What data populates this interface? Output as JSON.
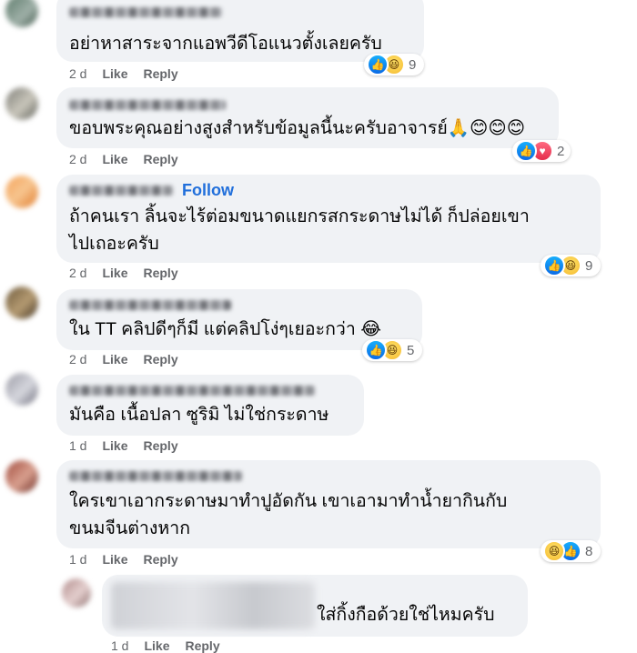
{
  "comments": [
    {
      "text_lines": [
        "อย่าหาสาระจากแอพวีดีโอแนวตั้งเลยครับ"
      ],
      "time": "2 d",
      "like": "Like",
      "reply": "Reply",
      "reactions": "9"
    },
    {
      "text_lines": [
        "ขอบพระคุณอย่างสูงสำหรับข้อมูลนี้นะครับอาจารย์🙏😊😊😊"
      ],
      "time": "2 d",
      "like": "Like",
      "reply": "Reply",
      "reactions": "2"
    },
    {
      "follow": "Follow",
      "text_lines": [
        "ถ้าคนเรา ลิ้นจะไร้ต่อมขนาดแยกรสกระดาษไม่ได้ ก็ปล่อยเขา",
        "ไปเถอะครับ"
      ],
      "time": "2 d",
      "like": "Like",
      "reply": "Reply",
      "reactions": "9"
    },
    {
      "text_lines": [
        "ใน TT คลิปดีๆก็มี แต่คลิปโง่ๆเยอะกว่า 😂"
      ],
      "time": "2 d",
      "like": "Like",
      "reply": "Reply",
      "reactions": "5"
    },
    {
      "text_lines": [
        "มันคือ เนื้อปลา ซูริมิ ไม่ใช่กระดาษ"
      ],
      "time": "1 d",
      "like": "Like",
      "reply": "Reply"
    },
    {
      "text_lines": [
        "ใครเขาเอากระดาษมาทำปูอัดกัน เขาเอามาทำน้ำยากินกับ",
        "ขนมจีนต่างหาก"
      ],
      "time": "1 d",
      "like": "Like",
      "reply": "Reply",
      "reactions": "8"
    },
    {
      "text_lines": [
        "ใส่กิ้งกือด้วยใช่ไหมครับ"
      ],
      "time": "1 d",
      "like": "Like",
      "reply": "Reply"
    }
  ],
  "icons": {
    "like": "thumbs-up-icon",
    "haha": "laughing-face-icon",
    "love": "heart-icon"
  },
  "colors": {
    "bubble": "#f0f2f5",
    "meta_text": "#65676b",
    "follow_blue": "#216fdb",
    "like_blue": "#0a6ae6"
  }
}
